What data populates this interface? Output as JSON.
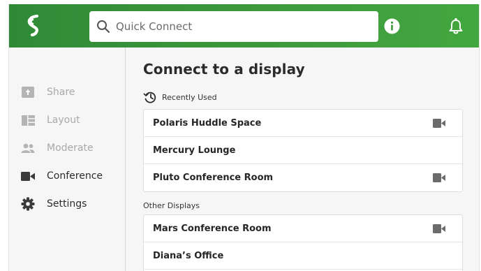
{
  "search": {
    "placeholder": "Quick Connect"
  },
  "sidebar": {
    "items": [
      {
        "label": "Share",
        "icon": "share-icon",
        "state": "disabled"
      },
      {
        "label": "Layout",
        "icon": "layout-icon",
        "state": "disabled"
      },
      {
        "label": "Moderate",
        "icon": "people-icon",
        "state": "disabled"
      },
      {
        "label": "Conference",
        "icon": "video-camera-icon",
        "state": "active"
      },
      {
        "label": "Settings",
        "icon": "gear-icon",
        "state": "active"
      }
    ]
  },
  "main": {
    "title": "Connect to a display",
    "recent": {
      "label": "Recently Used",
      "displays": [
        {
          "name": "Polaris Huddle Space",
          "camera": true
        },
        {
          "name": "Mercury Lounge",
          "camera": false
        },
        {
          "name": "Pluto Conference Room",
          "camera": true
        }
      ]
    },
    "other": {
      "label": "Other Displays",
      "displays": [
        {
          "name": "Mars Conference Room",
          "camera": true
        },
        {
          "name": "Diana’s Office",
          "camera": false
        }
      ]
    }
  },
  "colors": {
    "header_green": "#3c9a3c",
    "icon_gray": "#6b6b6b",
    "disabled_gray": "#a9a9a9",
    "text_dark": "#2b2b2b"
  }
}
